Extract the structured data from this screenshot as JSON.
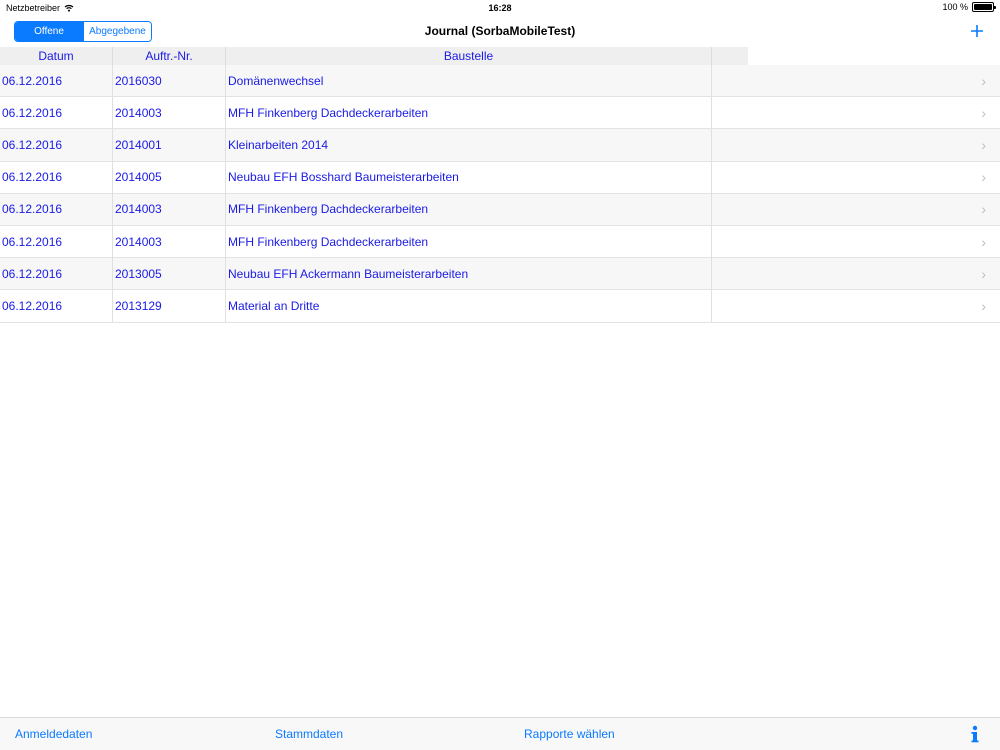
{
  "status_bar": {
    "carrier": "Netzbetreiber",
    "time": "16:28",
    "battery": "100 %",
    "icons": [
      "wifi-icon",
      "battery-icon"
    ]
  },
  "nav": {
    "segments": [
      "Offene",
      "Abgegebene"
    ],
    "selected_segment": "Offene",
    "title": "Journal (SorbaMobileTest)",
    "add_icon": "plus-icon"
  },
  "table": {
    "columns": [
      "Datum",
      "Auftr.-Nr.",
      "Baustelle"
    ],
    "rows": [
      {
        "date": "06.12.2016",
        "order": "2016030",
        "site": "Domänenwechsel"
      },
      {
        "date": "06.12.2016",
        "order": "2014003",
        "site": "MFH Finkenberg Dachdeckerarbeiten"
      },
      {
        "date": "06.12.2016",
        "order": "2014001",
        "site": "Kleinarbeiten 2014"
      },
      {
        "date": "06.12.2016",
        "order": "2014005",
        "site": "Neubau EFH Bosshard Baumeisterarbeiten"
      },
      {
        "date": "06.12.2016",
        "order": "2014003",
        "site": "MFH Finkenberg Dachdeckerarbeiten"
      },
      {
        "date": "06.12.2016",
        "order": "2014003",
        "site": "MFH Finkenberg Dachdeckerarbeiten"
      },
      {
        "date": "06.12.2016",
        "order": "2013005",
        "site": "Neubau EFH Ackermann Baumeisterarbeiten"
      },
      {
        "date": "06.12.2016",
        "order": "2013129",
        "site": "Material an Dritte"
      }
    ]
  },
  "toolbar": {
    "items": [
      "Anmeldedaten",
      "Stammdaten",
      "Rapporte wählen"
    ],
    "info_icon": "info-icon"
  },
  "colors": {
    "accent": "#0a7aff",
    "cell_text": "#1a1ae6",
    "header_bg": "#efefef"
  }
}
